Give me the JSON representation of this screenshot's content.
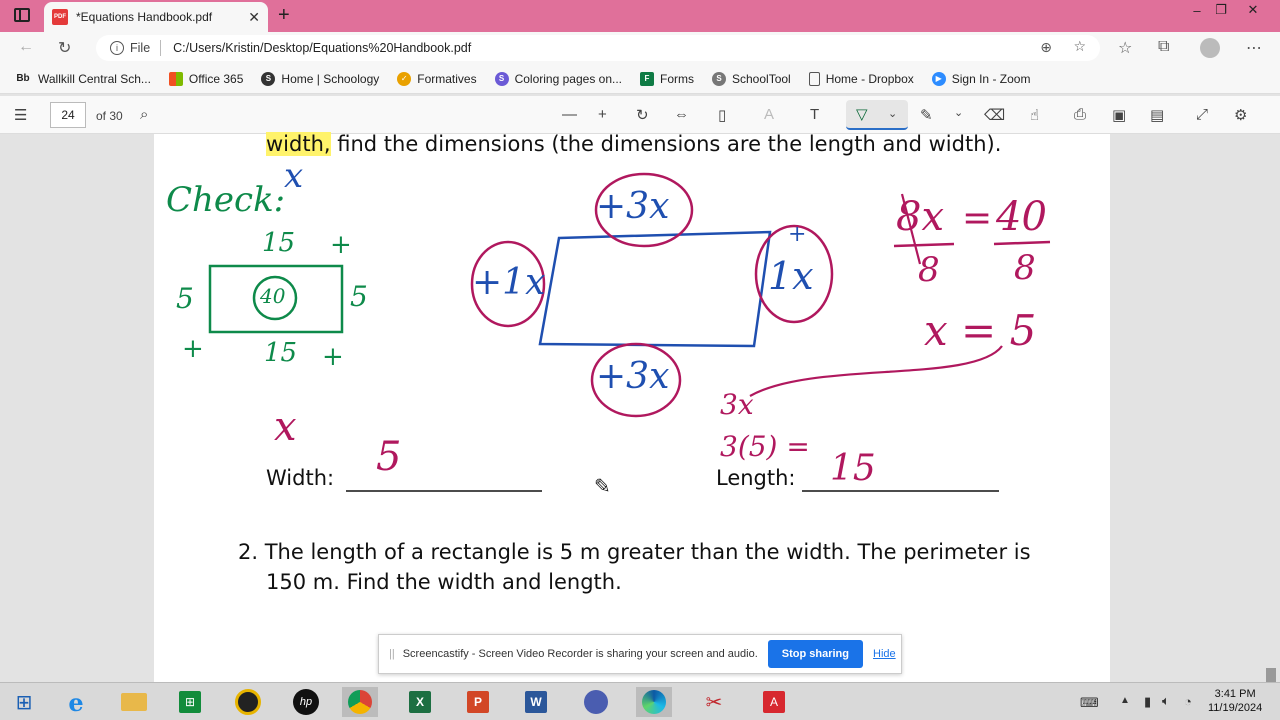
{
  "browser": {
    "tab_title": "*Equations Handbook.pdf",
    "file_label": "File",
    "url": "C:/Users/Kristin/Desktop/Equations%20Handbook.pdf"
  },
  "bookmarks": [
    {
      "label": "Wallkill Central Sch...",
      "icon": "bb-icon",
      "color": "#222222"
    },
    {
      "label": "Office 365",
      "icon": "office-icon",
      "color": "#e74c1c"
    },
    {
      "label": "Home | Schoology",
      "icon": "schoology-icon",
      "color": "#333333"
    },
    {
      "label": "Formatives",
      "icon": "formatives-icon",
      "color": "#e9a100"
    },
    {
      "label": "Coloring pages on...",
      "icon": "coloring-icon",
      "color": "#6b5ad6"
    },
    {
      "label": "Forms",
      "icon": "forms-icon",
      "color": "#0f7b45"
    },
    {
      "label": "SchoolTool",
      "icon": "schooltool-icon",
      "color": "#555555"
    },
    {
      "label": "Home - Dropbox",
      "icon": "page-icon",
      "color": "#555555"
    },
    {
      "label": "Sign In - Zoom",
      "icon": "zoom-icon",
      "color": "#2d8cff"
    }
  ],
  "pdf_toolbar": {
    "page_number": "24",
    "page_count": "of 30"
  },
  "document": {
    "line_top_highlight": "width,",
    "line_top_rest": " find the dimensions (the dimensions are the length and width).",
    "width_label": "Width:",
    "length_label": "Length:",
    "problem2_line1": "2. The length of a rectangle is 5 m greater than the width. The perimeter is",
    "problem2_line2": "150 m. Find the width and length."
  },
  "handwriting": {
    "check": "Check:",
    "x_top": "x",
    "check_top": "15",
    "check_bottom": "15",
    "check_left": "5",
    "check_right": "5",
    "check_area": "40",
    "plus": "+",
    "top_side": "+3x",
    "bottom_side": "+3x",
    "left_side": "+1x",
    "right_side": "1x",
    "eq_left": "8x",
    "eq_equals": "=",
    "eq_right": "40",
    "eq_den_left": "8",
    "eq_den_right": "8",
    "x_equals_5": "x = 5",
    "three_x": "3x",
    "three_of_five": "3(5) =",
    "x_mid": "x",
    "width_answer": "5",
    "length_answer": "15"
  },
  "notification": {
    "message": "Screencastify - Screen Video Recorder is sharing your screen and audio.",
    "stop_label": "Stop sharing",
    "hide_label": "Hide"
  },
  "clock": {
    "time": "3:41 PM",
    "date": "11/19/2024"
  },
  "colors": {
    "tabstrip": "#e0709a",
    "ink_green": "#0e8a4a",
    "ink_magenta": "#b0185e",
    "ink_blue": "#1f4fb0"
  }
}
